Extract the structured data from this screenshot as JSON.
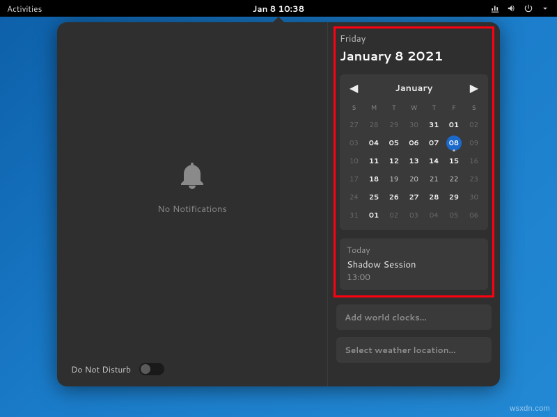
{
  "topbar": {
    "activities": "Activities",
    "datetime": "Jan 8  10:38"
  },
  "notifications": {
    "empty_label": "No Notifications",
    "dnd_label": "Do Not Disturb"
  },
  "date": {
    "weekday": "Friday",
    "full": "January 8 2021"
  },
  "calendar": {
    "month_label": "January",
    "weekday_headers": [
      "S",
      "M",
      "T",
      "W",
      "T",
      "F",
      "S"
    ],
    "weeks": [
      [
        {
          "n": "27",
          "dim": true
        },
        {
          "n": "28",
          "dim": true
        },
        {
          "n": "29",
          "dim": true
        },
        {
          "n": "30",
          "dim": true
        },
        {
          "n": "31",
          "bold": true
        },
        {
          "n": "01",
          "bold": true
        },
        {
          "n": "02",
          "dim": true
        }
      ],
      [
        {
          "n": "03",
          "dim": true
        },
        {
          "n": "04",
          "bold": true
        },
        {
          "n": "05",
          "bold": true
        },
        {
          "n": "06",
          "bold": true
        },
        {
          "n": "07",
          "bold": true
        },
        {
          "n": "08",
          "today": true,
          "dot": true
        },
        {
          "n": "09",
          "dim": true
        }
      ],
      [
        {
          "n": "10",
          "dim": true
        },
        {
          "n": "11",
          "bold": true
        },
        {
          "n": "12",
          "bold": true
        },
        {
          "n": "13",
          "bold": true
        },
        {
          "n": "14",
          "bold": true
        },
        {
          "n": "15",
          "bold": true
        },
        {
          "n": "16",
          "dim": true
        }
      ],
      [
        {
          "n": "17",
          "dim": true
        },
        {
          "n": "18",
          "bold": true
        },
        {
          "n": "19"
        },
        {
          "n": "20"
        },
        {
          "n": "21"
        },
        {
          "n": "22"
        },
        {
          "n": "23",
          "dim": true
        }
      ],
      [
        {
          "n": "24",
          "dim": true
        },
        {
          "n": "25",
          "bold": true
        },
        {
          "n": "26",
          "bold": true
        },
        {
          "n": "27",
          "bold": true
        },
        {
          "n": "28",
          "bold": true
        },
        {
          "n": "29",
          "bold": true
        },
        {
          "n": "30",
          "dim": true
        }
      ],
      [
        {
          "n": "31",
          "dim": true
        },
        {
          "n": "01",
          "bold": true
        },
        {
          "n": "02",
          "dim": true
        },
        {
          "n": "03",
          "dim": true
        },
        {
          "n": "04",
          "dim": true
        },
        {
          "n": "05",
          "dim": true
        },
        {
          "n": "06",
          "dim": true
        }
      ]
    ]
  },
  "events": {
    "header": "Today",
    "items": [
      {
        "title": "Shadow Session",
        "time": "13:00"
      }
    ]
  },
  "actions": {
    "world_clocks": "Add world clocks…",
    "weather": "Select weather location…"
  },
  "watermark": "wsxdn.com"
}
